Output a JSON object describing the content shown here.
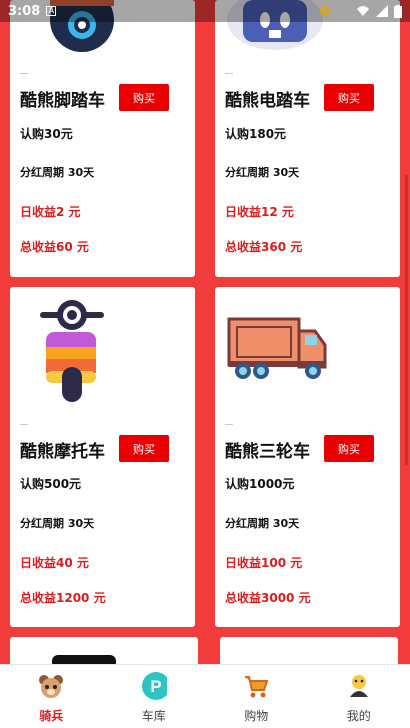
{
  "status": {
    "time": "3:08",
    "a": "A"
  },
  "products": [
    {
      "title": "酷熊脚踏车",
      "buy": "购买",
      "price": "认购30元",
      "cycle": "分红周期 30天",
      "daily": "日收益2 元",
      "total": "总收益60 元",
      "icon": "minion-icon"
    },
    {
      "title": "酷熊电踏车",
      "buy": "购买",
      "price": "认购180元",
      "cycle": "分红周期 30天",
      "daily": "日收益12 元",
      "total": "总收益360 元",
      "icon": "robot-icon"
    },
    {
      "title": "酷熊摩托车",
      "buy": "购买",
      "price": "认购500元",
      "cycle": "分红周期 30天",
      "daily": "日收益40 元",
      "total": "总收益1200 元",
      "icon": "scooter-icon"
    },
    {
      "title": "酷熊三轮车",
      "buy": "购买",
      "price": "认购1000元",
      "cycle": "分红周期 30天",
      "daily": "日收益100 元",
      "total": "总收益3000 元",
      "icon": "truck-icon"
    }
  ],
  "nav": [
    {
      "label": "骑兵",
      "icon": "bear-icon",
      "active": true
    },
    {
      "label": "车库",
      "icon": "parking-icon",
      "active": false
    },
    {
      "label": "购物",
      "icon": "cart-icon",
      "active": false
    },
    {
      "label": "我的",
      "icon": "avatar-icon",
      "active": false
    }
  ],
  "colors": {
    "background": "#f23c3c",
    "accent": "#e80000",
    "income": "#e01b1b"
  }
}
